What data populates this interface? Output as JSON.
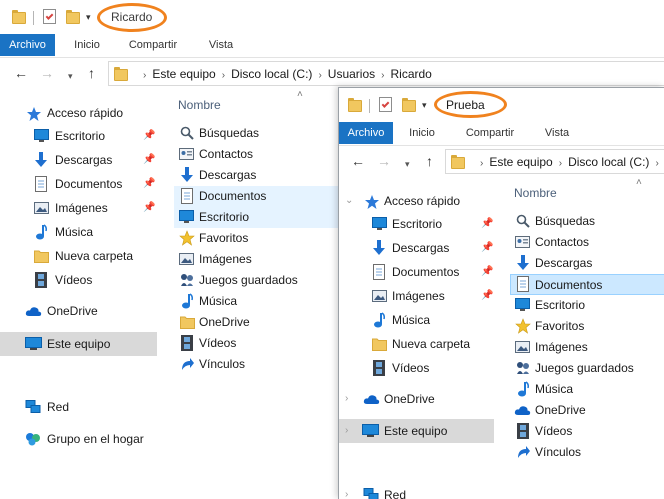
{
  "back_window": {
    "title": "Ricardo",
    "ribbon_tabs": [
      "Archivo",
      "Inicio",
      "Compartir",
      "Vista"
    ],
    "breadcrumb": [
      "Este equipo",
      "Disco local (C:)",
      "Usuarios",
      "Ricardo"
    ],
    "nav": {
      "quick_access": "Acceso rápido",
      "items": [
        "Escritorio",
        "Descargas",
        "Documentos",
        "Imágenes",
        "Música",
        "Nueva carpeta",
        "Vídeos"
      ],
      "onedrive": "OneDrive",
      "this_pc": "Este equipo",
      "network": "Red",
      "homegroup": "Grupo en el hogar"
    },
    "column_header": "Nombre",
    "files": [
      "Búsquedas",
      "Contactos",
      "Descargas",
      "Documentos",
      "Escritorio",
      "Favoritos",
      "Imágenes",
      "Juegos guardados",
      "Música",
      "OneDrive",
      "Vídeos",
      "Vínculos"
    ]
  },
  "front_window": {
    "title": "Prueba",
    "ribbon_tabs": [
      "Archivo",
      "Inicio",
      "Compartir",
      "Vista"
    ],
    "breadcrumb": [
      "Este equipo",
      "Disco local (C:)"
    ],
    "nav": {
      "quick_access": "Acceso rápido",
      "items": [
        "Escritorio",
        "Descargas",
        "Documentos",
        "Imágenes",
        "Música",
        "Nueva carpeta",
        "Vídeos"
      ],
      "onedrive": "OneDrive",
      "this_pc": "Este equipo",
      "network": "Red"
    },
    "column_header": "Nombre",
    "files": [
      "Búsquedas",
      "Contactos",
      "Descargas",
      "Documentos",
      "Escritorio",
      "Favoritos",
      "Imágenes",
      "Juegos guardados",
      "Música",
      "OneDrive",
      "Vídeos",
      "Vínculos"
    ]
  },
  "colors": {
    "file_tab": "#1a73c4",
    "selection": "#cce8ff",
    "hover": "#e5f3ff",
    "nav_selected": "#d9d9d9",
    "annotation": "#f0821e"
  }
}
